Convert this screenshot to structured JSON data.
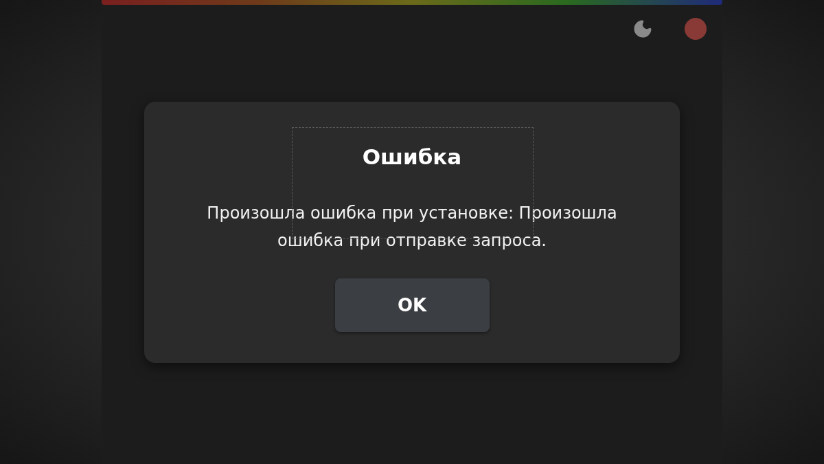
{
  "dialog": {
    "title": "Ошибка",
    "message": "Произошла ошибка при установке: Произошла ошибка при отправке запроса.",
    "buttons": [
      "OK"
    ]
  }
}
